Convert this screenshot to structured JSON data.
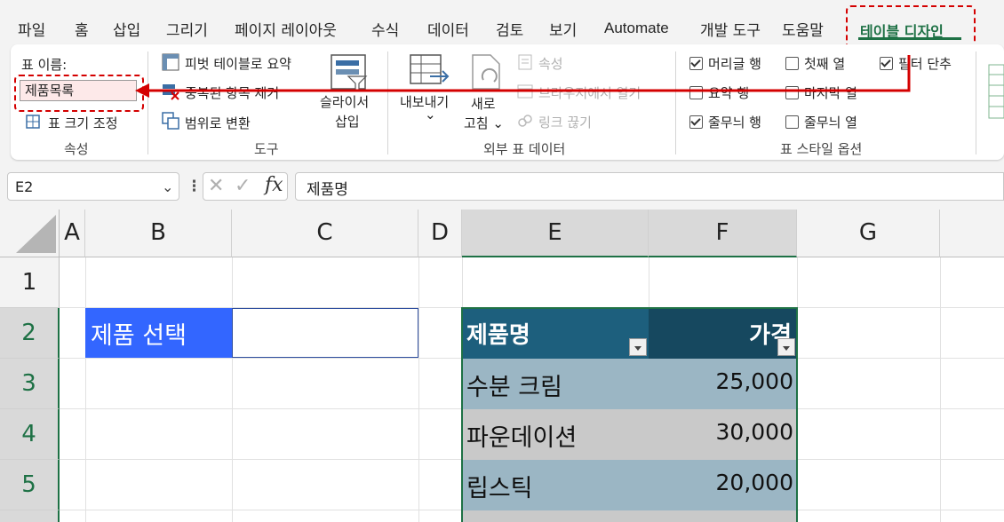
{
  "menu": {
    "tabs": [
      "파일",
      "홈",
      "삽입",
      "그리기",
      "페이지 레이아웃",
      "수식",
      "데이터",
      "검토",
      "보기",
      "Automate",
      "개발 도구",
      "도움말",
      "테이블 디자인"
    ],
    "active_tab": "테이블 디자인"
  },
  "ribbon": {
    "properties": {
      "table_name_label": "표 이름:",
      "table_name_value": "제품목록",
      "resize_label": "표 크기 조정",
      "group_label": "속성"
    },
    "tools": {
      "pivot_label": "피벗 테이블로 요약",
      "remove_duplicates_label": "중복된 항목 제거",
      "convert_range_label": "범위로 변환",
      "slicer_label_1": "슬라이서",
      "slicer_label_2": "삽입",
      "group_label": "도구"
    },
    "external": {
      "export_label": "내보내기",
      "export_chevron": "⌄",
      "refresh_label_1": "새로",
      "refresh_label_2": "고침 ⌄",
      "properties_label": "속성",
      "open_browser_label": "브라우저에서 열기",
      "unlink_label": "링크 끊기",
      "group_label": "외부 표 데이터"
    },
    "style_options": {
      "header_row": {
        "label": "머리글 행",
        "checked": true
      },
      "total_row": {
        "label": "요약 행",
        "checked": false
      },
      "banded_rows": {
        "label": "줄무늬 행",
        "checked": true
      },
      "first_column": {
        "label": "첫째 열",
        "checked": false
      },
      "last_column": {
        "label": "마지막 열",
        "checked": false
      },
      "banded_columns": {
        "label": "줄무늬 열",
        "checked": false
      },
      "filter_button": {
        "label": "필터 단추",
        "checked": true
      },
      "group_label": "표 스타일 옵션"
    }
  },
  "formula_bar": {
    "name_box": "E2",
    "fx_label": "fx",
    "formula": "제품명"
  },
  "sheet": {
    "columns": [
      "A",
      "B",
      "C",
      "D",
      "E",
      "F",
      "G"
    ],
    "rows": [
      "1",
      "2",
      "3",
      "4",
      "5"
    ],
    "b2_label": "제품 선택",
    "table_headers": [
      "제품명",
      "가격"
    ],
    "table_rows": [
      {
        "name": "수분 크림",
        "price": "25,000"
      },
      {
        "name": "파운데이션",
        "price": "30,000"
      },
      {
        "name": "립스틱",
        "price": "20,000"
      }
    ]
  },
  "colors": {
    "accent_green": "#1e7145",
    "annotation_red": "#d40000",
    "table_header": "#1d5f7d",
    "table_header_dark": "#16485f",
    "band_light": "#9bb6c4",
    "band_grey": "#c9c9c9",
    "b2_fill": "#3366ff"
  }
}
